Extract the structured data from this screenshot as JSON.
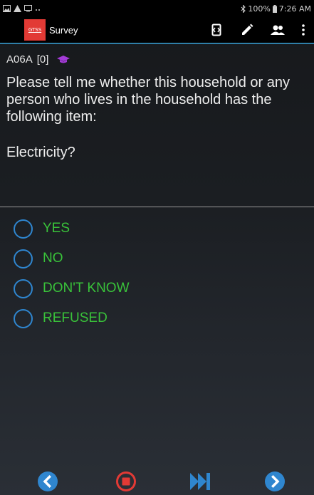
{
  "status_bar": {
    "battery": "100%",
    "time": "7:26 AM",
    "icons": [
      "image-icon",
      "alert-icon",
      "screen-icon",
      "more-icon",
      "bluetooth-icon",
      "battery-icon"
    ]
  },
  "app_bar": {
    "logo_text": "GTSS",
    "title": "Survey",
    "actions": [
      "screen-rotate-icon",
      "pencil-icon",
      "people-icon",
      "overflow-menu-icon"
    ]
  },
  "question": {
    "code": "A06A",
    "index": "[0]",
    "text": "Please tell me whether this household or any person who lives in the household has the following item:",
    "item": "Electricity?"
  },
  "options": [
    {
      "label": "YES",
      "selected": false
    },
    {
      "label": "NO",
      "selected": false
    },
    {
      "label": "DON'T KNOW",
      "selected": false
    },
    {
      "label": "REFUSED",
      "selected": false
    }
  ],
  "bottom_nav": [
    "back-icon",
    "stop-icon",
    "fast-forward-icon",
    "next-icon"
  ],
  "colors": {
    "accent_blue": "#2f86cf",
    "option_green": "#39c23a",
    "stop_red": "#e23a35",
    "appbar_underline": "#2f7fa8",
    "cap_purple": "#a43bd8"
  }
}
